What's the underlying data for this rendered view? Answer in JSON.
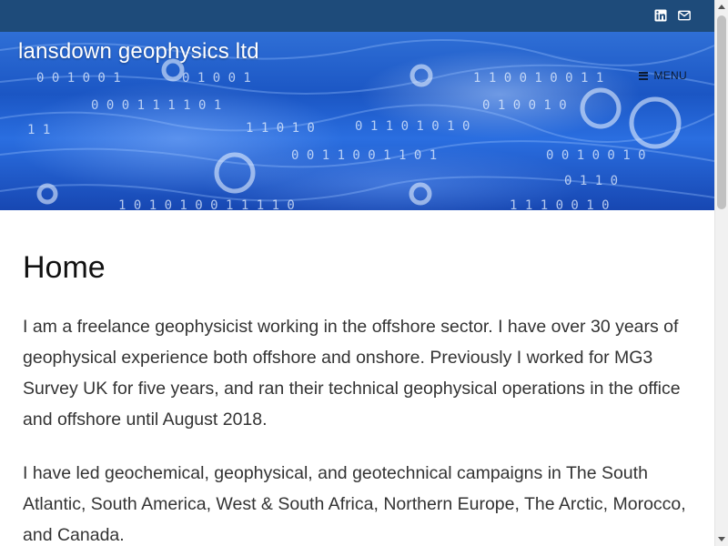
{
  "topbar": {
    "icons": [
      "linkedin-icon",
      "envelope-icon"
    ],
    "color": "#1e4b7a"
  },
  "header": {
    "site_title": "lansdown geophysics ltd",
    "menu_label": "MENU"
  },
  "main": {
    "title": "Home",
    "paragraphs": [
      "I am a freelance geophysicist working in the offshore sector. I have over 30 years of geophysical experience both offshore and onshore. Previously I worked for MG3 Survey UK for five years, and ran their technical geophysical operations in the office and offshore until August 2018.",
      "I have led geochemical, geophysical, and geotechnical campaigns in The South Atlantic, South America, West & South Africa, Northern Europe, The Arctic, Morocco, and Canada."
    ]
  },
  "colors": {
    "accent": "#1e4b7a",
    "header_blue": "#1b56c4",
    "text": "#333333"
  }
}
